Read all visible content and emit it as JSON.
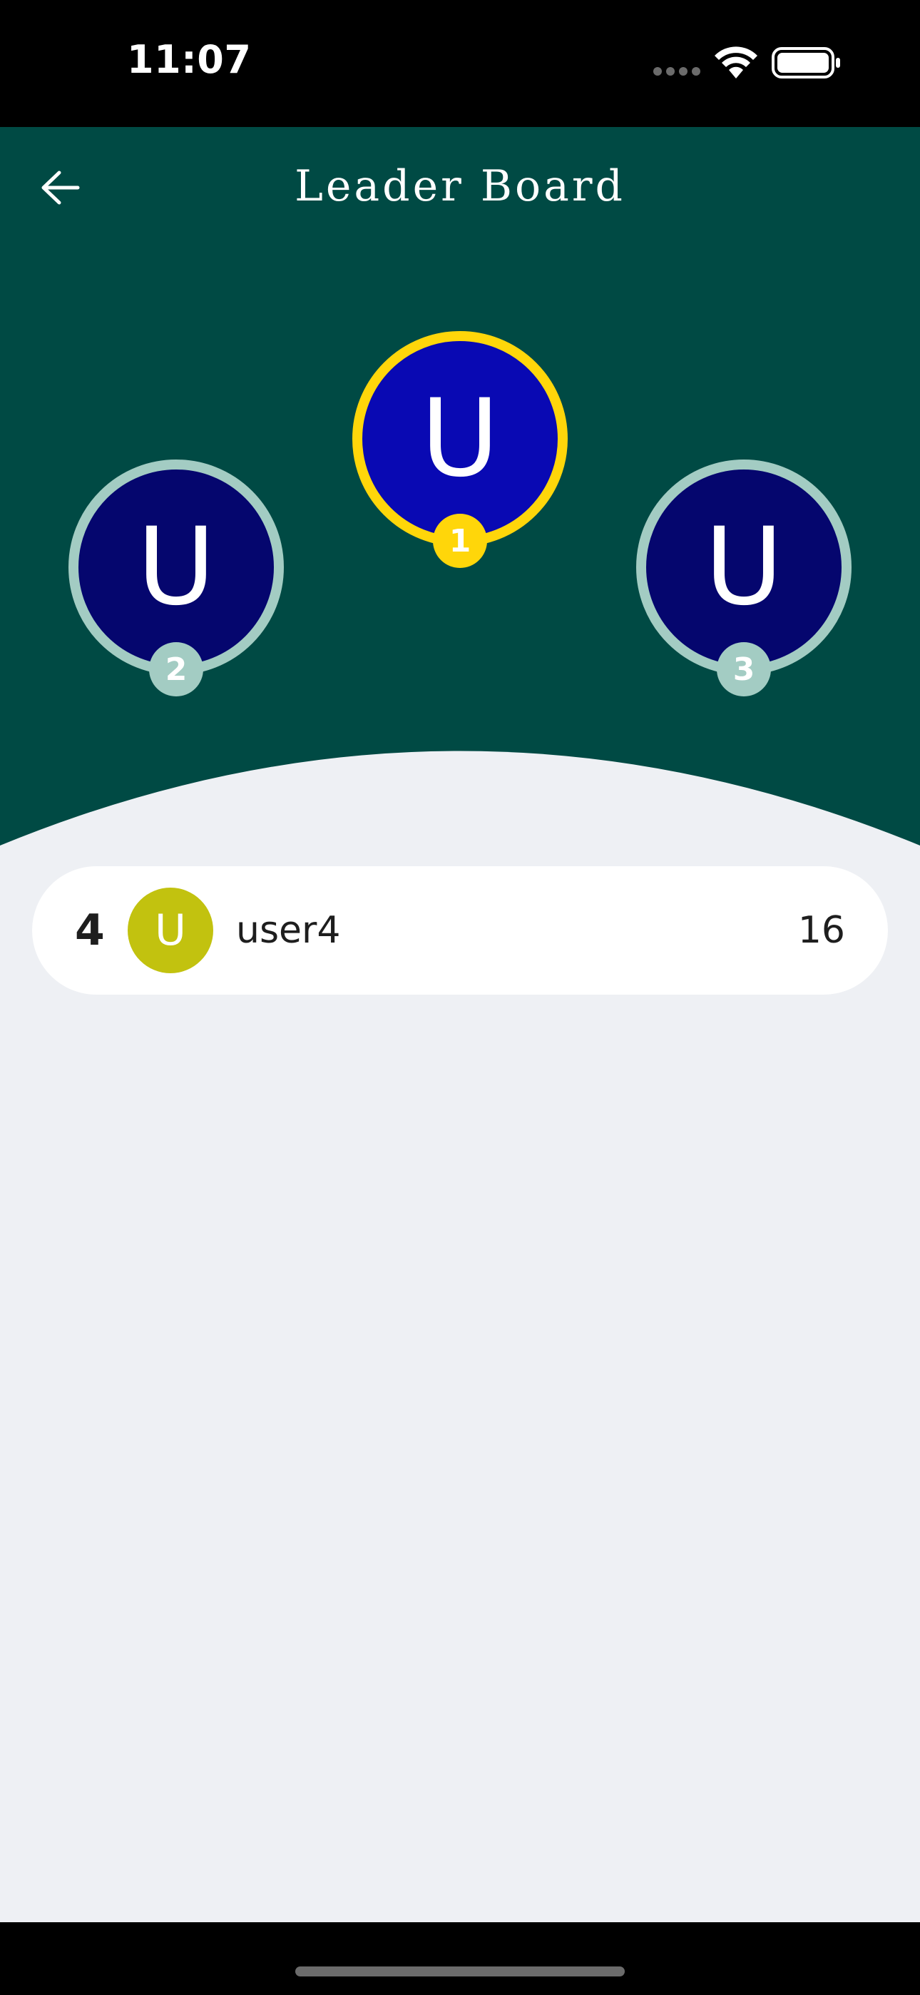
{
  "status_bar": {
    "time": "11:07"
  },
  "header": {
    "title": "Leader Board",
    "back_icon": "arrow-left-icon"
  },
  "podium": {
    "crown_icon": "crown-icon",
    "first": {
      "initial": "U",
      "rank": "1"
    },
    "second": {
      "initial": "U",
      "rank": "2"
    },
    "third": {
      "initial": "U",
      "rank": "3"
    }
  },
  "leaderboard": {
    "rows": [
      {
        "rank": "4",
        "initial": "U",
        "name": "user4",
        "score": "16"
      }
    ]
  },
  "colors": {
    "header_bg": "#004a44",
    "page_bg": "#eef0f4",
    "gold": "#ffd60a",
    "silver_ring": "#a3ccc3",
    "first_avatar": "#0909b3",
    "other_avatar": "#05066e",
    "row_avatar": "#c2c20f"
  }
}
